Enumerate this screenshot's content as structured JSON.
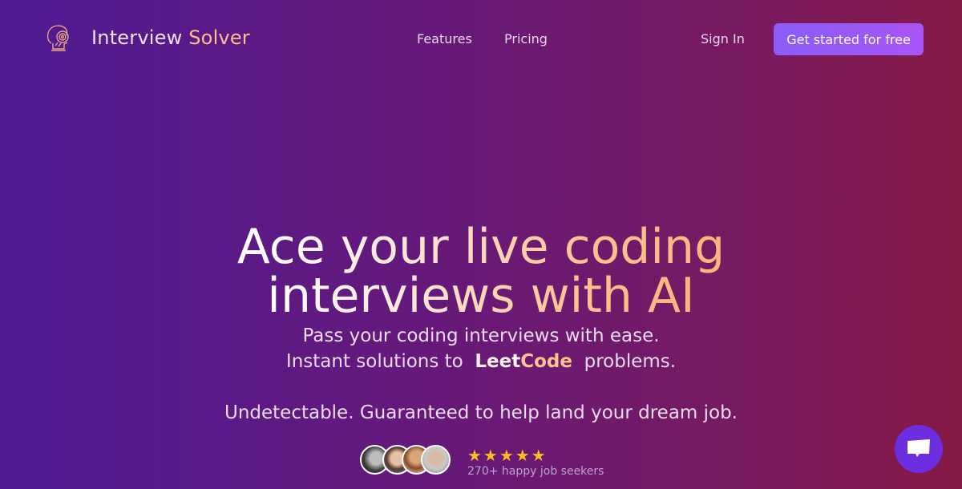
{
  "nav": {
    "brand_part1": "Interview",
    "brand_part2": "Solver",
    "links": [
      {
        "label": "Features"
      },
      {
        "label": "Pricing"
      }
    ],
    "sign_in": "Sign In",
    "cta": "Get started for free"
  },
  "hero": {
    "title_line1": "Ace your live coding",
    "title_line2": "interviews with AI",
    "sub_line1": "Pass your coding interviews with ease.",
    "sub_line2_pre": "Instant solutions to",
    "leetcode_part1": "Leet",
    "leetcode_part2": "Code",
    "sub_line2_post": "problems.",
    "sub_line3": "Undetectable. Guaranteed to help land your dream job."
  },
  "social_proof": {
    "stars": "★★★★★",
    "rating": 5,
    "text": "270+ happy job seekers",
    "avatars": [
      "user-avatar-1",
      "user-avatar-2",
      "user-avatar-3",
      "user-avatar-4"
    ]
  },
  "chat": {
    "icon": "chat-bubble-icon"
  },
  "colors": {
    "cta": "#8b5cf6",
    "accent_peach": "#fbbf8a",
    "star": "#fbbf24",
    "chat": "#6d2ee0"
  }
}
